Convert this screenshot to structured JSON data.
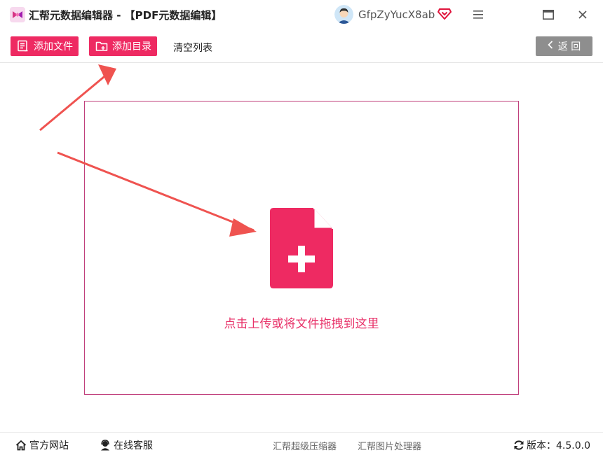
{
  "titlebar": {
    "title": "汇帮元数据编辑器 - 【PDF元数据编辑】",
    "username": "GfpZyYucX8ab"
  },
  "toolbar": {
    "add_file": "添加文件",
    "add_folder": "添加目录",
    "clear_list": "清空列表",
    "back": "返 回"
  },
  "dropzone": {
    "text": "点击上传或将文件拖拽到这里"
  },
  "statusbar": {
    "official_site": "官方网站",
    "online_service": "在线客服",
    "compressor": "汇帮超级压缩器",
    "image_processor": "汇帮图片处理器",
    "version": "版本：4.5.0.0"
  },
  "colors": {
    "accent": "#ee2a62",
    "annotation_arrow": "#ef5350",
    "back_button": "#8e8e8e",
    "dropzone_border": "#c0407c"
  },
  "icons": {
    "app_logo": "app-logo-icon",
    "vip": "diamond-heart-icon",
    "menu": "hamburger-icon",
    "maximize": "maximize-icon",
    "close": "close-icon",
    "add_file": "document-list-icon",
    "add_folder": "folder-plus-icon",
    "back": "chevron-left-icon",
    "file_add": "file-plus-icon",
    "home": "home-icon",
    "service": "headset-icon",
    "refresh": "refresh-icon"
  }
}
